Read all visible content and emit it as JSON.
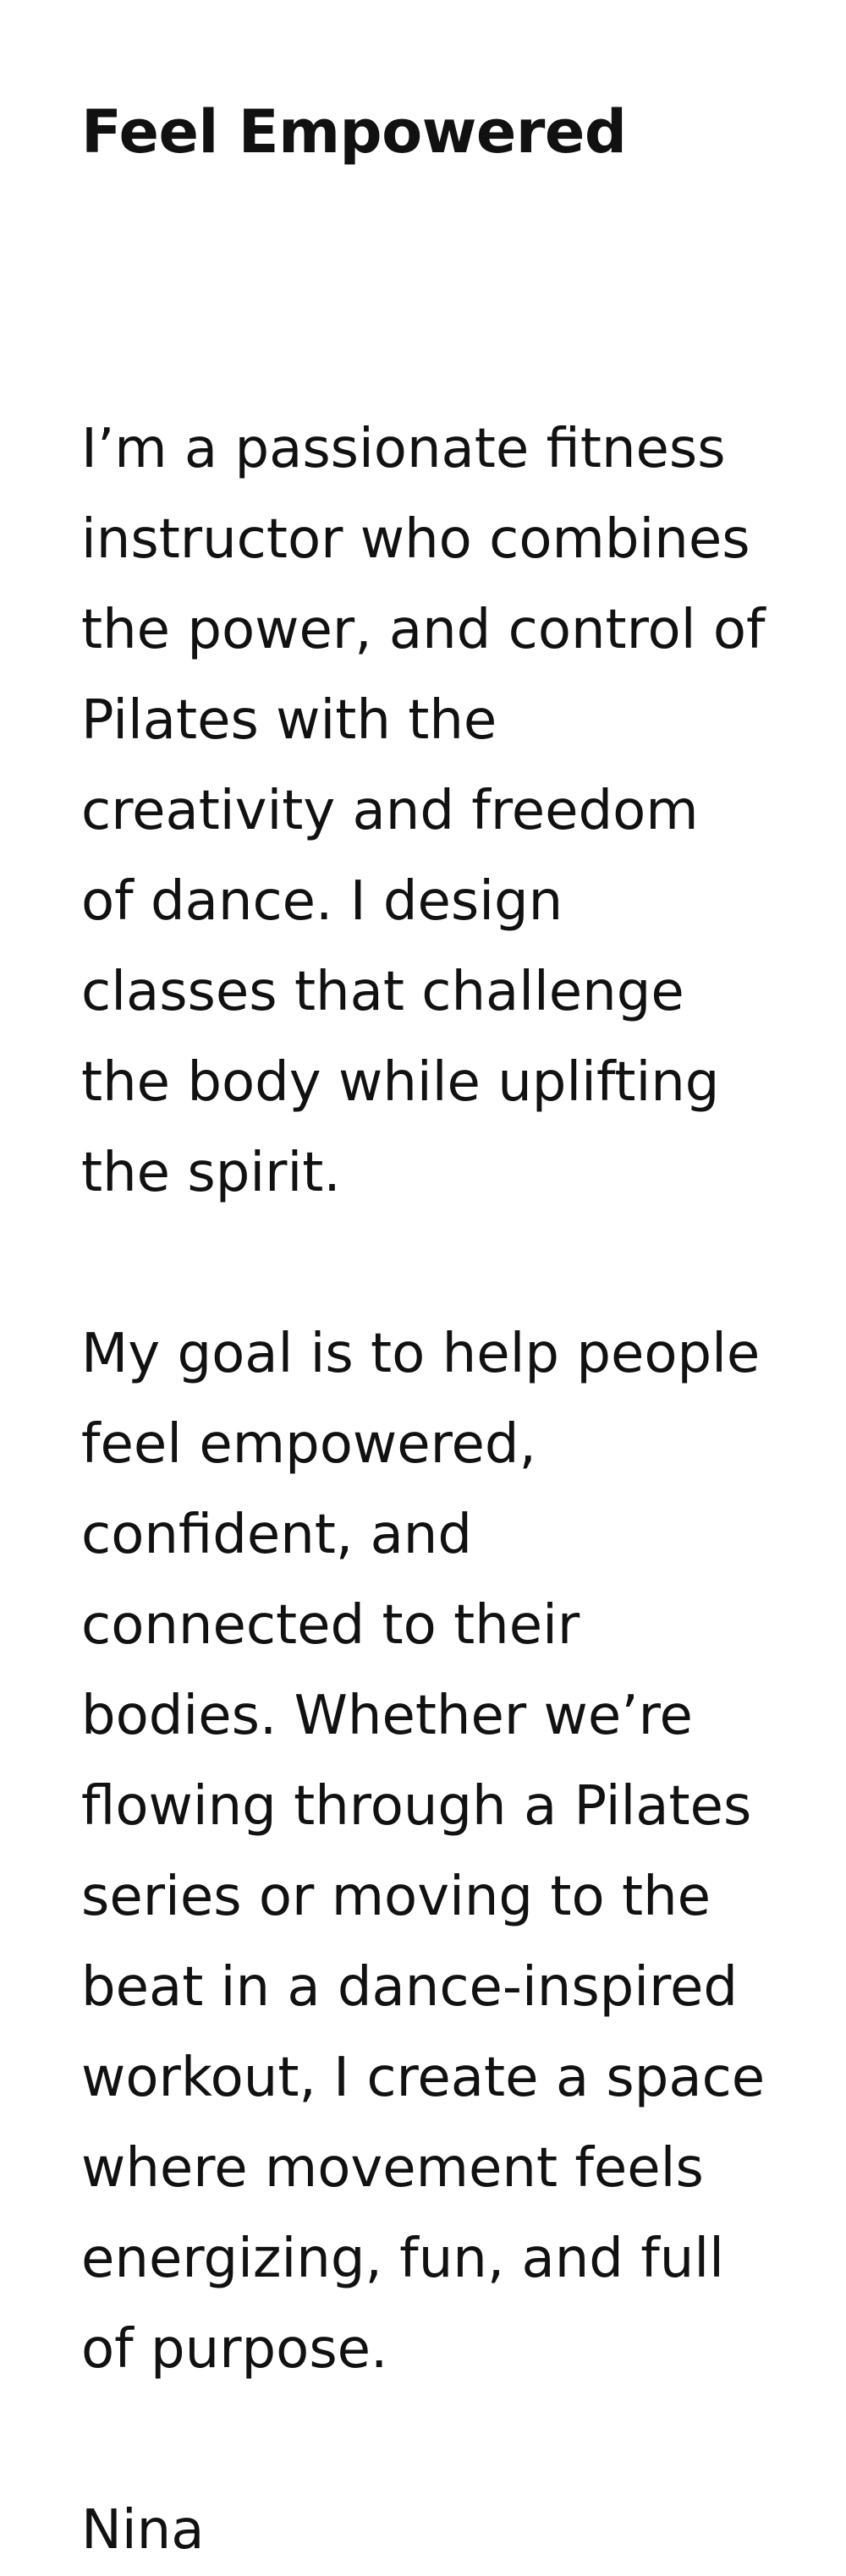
{
  "title": "Feel Empowered",
  "paragraphs": [
    "I’m a passionate fitness instructor who combines the power, and control of Pilates with the creativity and freedom of dance. I design classes that challenge the body while uplifting the spirit.",
    "My goal is to help people feel empowered, confident, and connected to their bodies. Whether we’re flowing through a Pilates series or moving to the beat in a dance-inspired workout, I create a space where movement feels energizing, fun, and full of purpose."
  ],
  "signature": "Nina"
}
